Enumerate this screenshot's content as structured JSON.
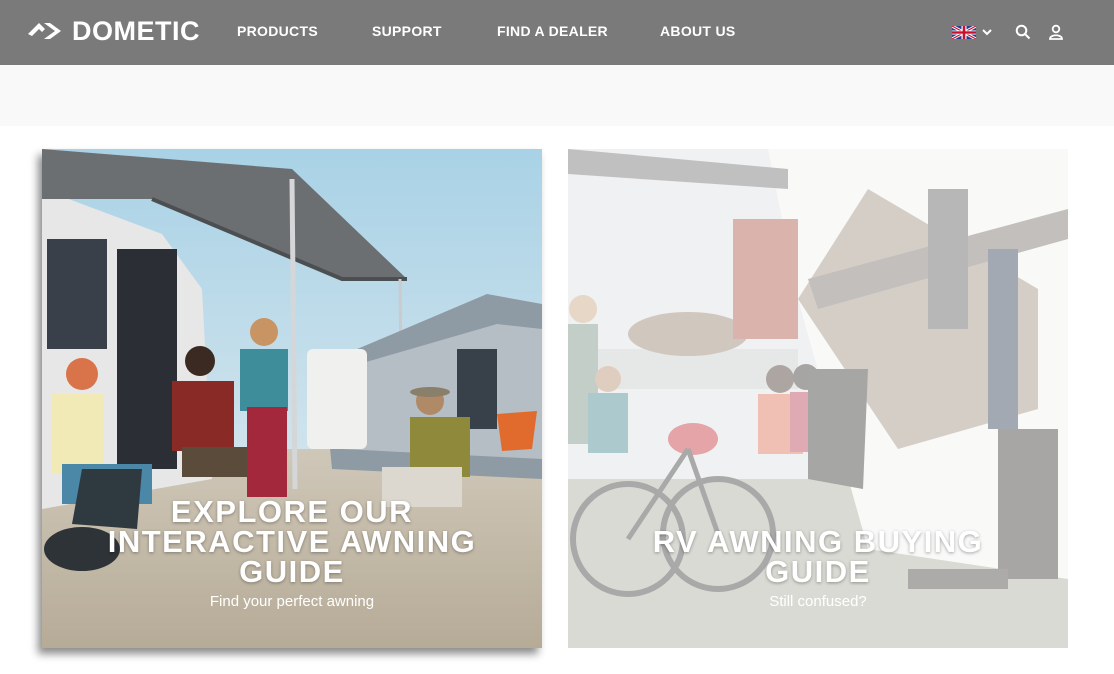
{
  "brand": {
    "name": "DOMETIC"
  },
  "nav": {
    "items": [
      {
        "label": "PRODUCTS"
      },
      {
        "label": "SUPPORT"
      },
      {
        "label": "FIND A DEALER"
      },
      {
        "label": "ABOUT US"
      }
    ]
  },
  "header_tools": {
    "language_icon": "uk-flag-icon",
    "language_chevron": "chevron-down-icon",
    "search_icon": "search-icon",
    "account_icon": "user-icon"
  },
  "cards": [
    {
      "title_line1": "EXPLORE OUR",
      "title_line2": "INTERACTIVE AWNING",
      "title_line3": "GUIDE",
      "subtitle": "Find your perfect awning"
    },
    {
      "title_line1": "RV AWNING BUYING",
      "title_line2": "GUIDE",
      "subtitle": "Still confused?"
    }
  ],
  "colors": {
    "header_bg": "#7a7a7a",
    "band_bg": "#faf9fa",
    "text_on_image": "#ffffff"
  }
}
